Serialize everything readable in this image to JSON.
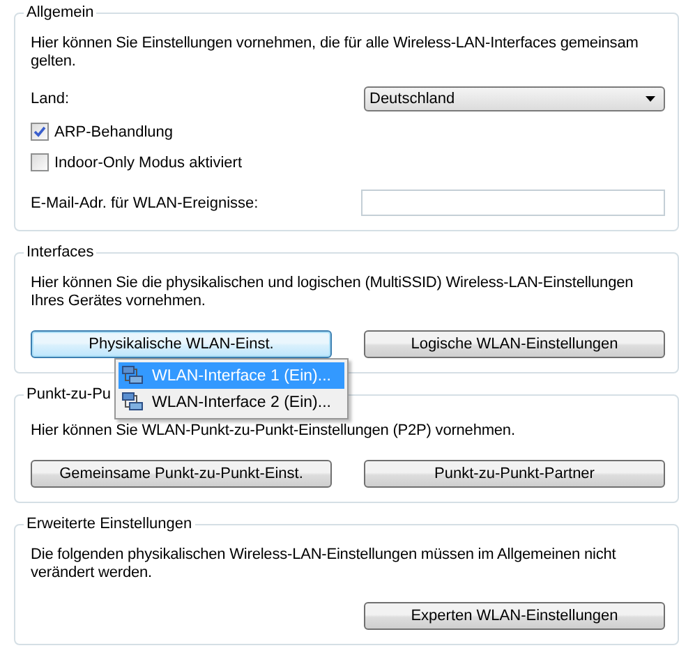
{
  "general": {
    "legend": "Allgemein",
    "description": "Hier können Sie Einstellungen vornehmen, die für alle Wireless-LAN-Interfaces gemeinsam gelten.",
    "country": {
      "label": "Land:",
      "value": "Deutschland"
    },
    "checkboxes": [
      {
        "label": "ARP-Behandlung",
        "checked": true
      },
      {
        "label": "Indoor-Only Modus aktiviert",
        "checked": false
      }
    ],
    "email": {
      "label": "E-Mail-Adr. für WLAN-Ereignisse:"
    }
  },
  "interfaces": {
    "legend": "Interfaces",
    "description": "Hier können Sie die physikalischen und logischen (MultiSSID) Wireless-LAN-Einstellungen Ihres Gerätes vornehmen.",
    "buttons": [
      {
        "label": "Physikalische WLAN-Einst.",
        "focused": true
      },
      {
        "label": "Logische WLAN-Einstellungen",
        "focused": false
      }
    ],
    "menu": [
      {
        "label": "WLAN-Interface 1 (Ein)...",
        "selected": true
      },
      {
        "label": "WLAN-Interface 2 (Ein)...",
        "selected": false
      }
    ]
  },
  "p2p": {
    "legend": "Punkt-zu-Pu",
    "description": "Hier können Sie WLAN-Punkt-zu-Punkt-Einstellungen (P2P) vornehmen.",
    "buttons": [
      {
        "label": "Gemeinsame Punkt-zu-Punkt-Einst.",
        "focused": false
      },
      {
        "label": "Punkt-zu-Punkt-Partner",
        "focused": false
      }
    ]
  },
  "expert": {
    "legend": "Erweiterte Einstellungen",
    "description": "Die folgenden physikalischen Wireless-LAN-Einstellungen müssen im Allgemeinen nicht verändert werden.",
    "buttons": [
      {
        "label": "Experten WLAN-Einstellungen",
        "focused": false
      }
    ]
  }
}
